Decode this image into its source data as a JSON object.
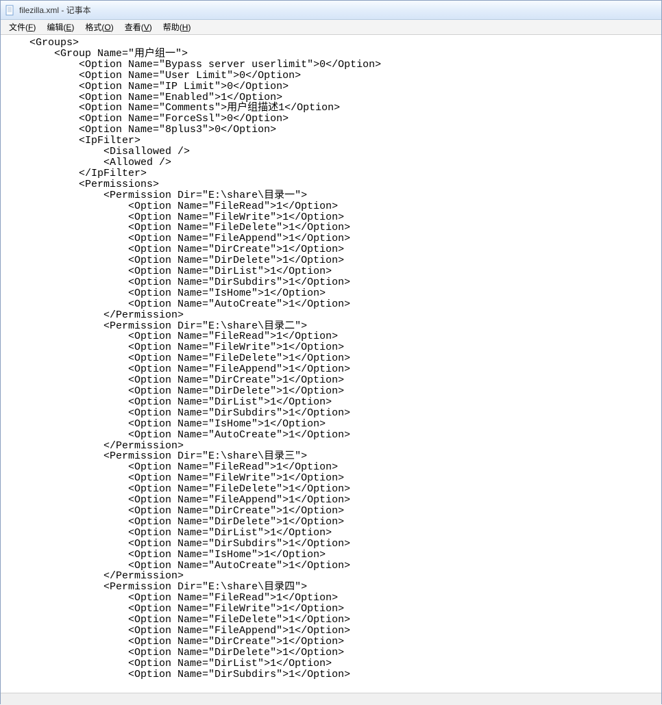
{
  "window": {
    "title": "filezilla.xml - 记事本"
  },
  "menu": {
    "file": "文件",
    "file_key": "F",
    "edit": "编辑",
    "edit_key": "E",
    "format": "格式",
    "format_key": "O",
    "view": "查看",
    "view_key": "V",
    "help": "帮助",
    "help_key": "H"
  },
  "doc": {
    "groups_open": "<Groups>",
    "group_open": "<Group Name=\"用户组一\">",
    "opt_bypass": "<Option Name=\"Bypass server userlimit\">0</Option>",
    "opt_userlimit": "<Option Name=\"User Limit\">0</Option>",
    "opt_iplimit": "<Option Name=\"IP Limit\">0</Option>",
    "opt_enabled": "<Option Name=\"Enabled\">1</Option>",
    "opt_comments": "<Option Name=\"Comments\">用户组描述1</Option>",
    "opt_forcessl": "<Option Name=\"ForceSsl\">0</Option>",
    "opt_8plus3": "<Option Name=\"8plus3\">0</Option>",
    "ipfilter_open": "<IpFilter>",
    "disallowed": "<Disallowed />",
    "allowed": "<Allowed />",
    "ipfilter_close": "</IpFilter>",
    "permissions_open": "<Permissions>",
    "perm1_open": "<Permission Dir=\"E:\\share\\目录一\">",
    "perm1_fread": "<Option Name=\"FileRead\">1</Option>",
    "perm1_fwrite": "<Option Name=\"FileWrite\">1</Option>",
    "perm1_fdelete": "<Option Name=\"FileDelete\">1</Option>",
    "perm1_fappend": "<Option Name=\"FileAppend\">1</Option>",
    "perm1_dircreate": "<Option Name=\"DirCreate\">1</Option>",
    "perm1_dirdelete": "<Option Name=\"DirDelete\">1</Option>",
    "perm1_dirlist": "<Option Name=\"DirList\">1</Option>",
    "perm1_dirsubdirs": "<Option Name=\"DirSubdirs\">1</Option>",
    "perm1_ishome": "<Option Name=\"IsHome\">1</Option>",
    "perm1_autocreate": "<Option Name=\"AutoCreate\">1</Option>",
    "perm_close": "</Permission>",
    "perm2_open": "<Permission Dir=\"E:\\share\\目录二\">",
    "perm2_fread": "<Option Name=\"FileRead\">1</Option>",
    "perm2_fwrite": "<Option Name=\"FileWrite\">1</Option>",
    "perm2_fdelete": "<Option Name=\"FileDelete\">1</Option>",
    "perm2_fappend": "<Option Name=\"FileAppend\">1</Option>",
    "perm2_dircreate": "<Option Name=\"DirCreate\">1</Option>",
    "perm2_dirdelete": "<Option Name=\"DirDelete\">1</Option>",
    "perm2_dirlist": "<Option Name=\"DirList\">1</Option>",
    "perm2_dirsubdirs": "<Option Name=\"DirSubdirs\">1</Option>",
    "perm2_ishome": "<Option Name=\"IsHome\">1</Option>",
    "perm2_autocreate": "<Option Name=\"AutoCreate\">1</Option>",
    "perm3_open": "<Permission Dir=\"E:\\share\\目录三\">",
    "perm3_fread": "<Option Name=\"FileRead\">1</Option>",
    "perm3_fwrite": "<Option Name=\"FileWrite\">1</Option>",
    "perm3_fdelete": "<Option Name=\"FileDelete\">1</Option>",
    "perm3_fappend": "<Option Name=\"FileAppend\">1</Option>",
    "perm3_dircreate": "<Option Name=\"DirCreate\">1</Option>",
    "perm3_dirdelete": "<Option Name=\"DirDelete\">1</Option>",
    "perm3_dirlist": "<Option Name=\"DirList\">1</Option>",
    "perm3_dirsubdirs": "<Option Name=\"DirSubdirs\">1</Option>",
    "perm3_ishome": "<Option Name=\"IsHome\">1</Option>",
    "perm3_autocreate": "<Option Name=\"AutoCreate\">1</Option>",
    "perm4_open": "<Permission Dir=\"E:\\share\\目录四\">",
    "perm4_fread": "<Option Name=\"FileRead\">1</Option>",
    "perm4_fwrite": "<Option Name=\"FileWrite\">1</Option>",
    "perm4_fdelete": "<Option Name=\"FileDelete\">1</Option>",
    "perm4_fappend": "<Option Name=\"FileAppend\">1</Option>",
    "perm4_dircreate": "<Option Name=\"DirCreate\">1</Option>",
    "perm4_dirdelete": "<Option Name=\"DirDelete\">1</Option>",
    "perm4_dirlist": "<Option Name=\"DirList\">1</Option>",
    "perm4_dirsubdirs": "<Option Name=\"DirSubdirs\">1</Option>"
  },
  "indent": {
    "i1": "    ",
    "i2": "        ",
    "i3": "            ",
    "i4": "                ",
    "i5": "                    "
  }
}
